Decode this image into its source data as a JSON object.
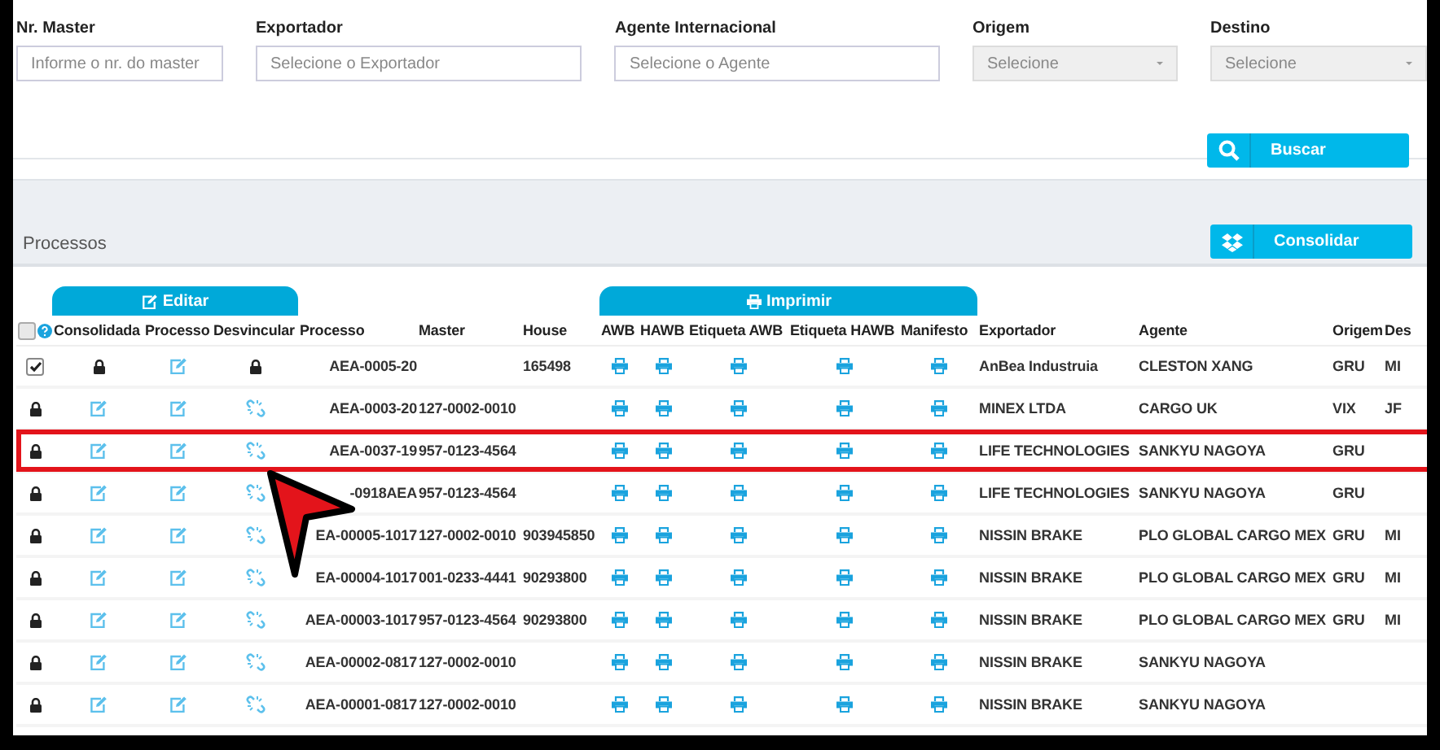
{
  "filters": [
    {
      "label": "Nr. Master",
      "kind": "text",
      "placeholder": "Informe o nr. do master",
      "disabled": false
    },
    {
      "label": "Exportador",
      "kind": "text",
      "placeholder": "Selecione o Exportador",
      "disabled": false
    },
    {
      "label": "Agente Internacional",
      "kind": "text",
      "placeholder": "Selecione o Agente",
      "disabled": false
    },
    {
      "label": "Origem",
      "kind": "select",
      "value": "Selecione",
      "disabled": true
    },
    {
      "label": "Destino",
      "kind": "select",
      "value": "Selecione",
      "disabled": true
    }
  ],
  "search_button": "Buscar",
  "section_title": "Processos",
  "consolidate_button": "Consolidar",
  "column_groups": [
    "Editar",
    "Imprimir"
  ],
  "select_all": {
    "checked": false
  },
  "columns": [
    "Consolidada",
    "Processo",
    "Desvincular",
    "Processo",
    "Master",
    "House",
    "AWB",
    "HAWB",
    "Etiqueta AWB",
    "Etiqueta HAWB",
    "Manifesto",
    "Exportador",
    "Agente",
    "Origem",
    "Des"
  ],
  "rows": [
    {
      "kind": "consolidated",
      "checked": true,
      "highlighted": false,
      "processo": "AEA-0005-20",
      "master": "",
      "house": "165498",
      "exportador": "AnBea Industruia",
      "agente": "CLESTON XANG",
      "origem": "GRU",
      "destino": "MI"
    },
    {
      "kind": "pending",
      "highlighted": false,
      "processo": "AEA-0003-20",
      "master": "127-0002-0010",
      "house": "",
      "exportador": "MINEX LTDA",
      "agente": "CARGO UK",
      "origem": "VIX",
      "destino": "JF"
    },
    {
      "kind": "pending",
      "highlighted": true,
      "processo": "AEA-0037-19",
      "master": "957-0123-4564",
      "house": "",
      "exportador": "LIFE TECHNOLOGIES",
      "agente": "SANKYU NAGOYA",
      "origem": "GRU",
      "destino": ""
    },
    {
      "kind": "pending",
      "highlighted": false,
      "processo": "-0918AEA",
      "master": "957-0123-4564",
      "house": "",
      "exportador": "LIFE TECHNOLOGIES",
      "agente": "SANKYU NAGOYA",
      "origem": "GRU",
      "destino": ""
    },
    {
      "kind": "pending",
      "highlighted": false,
      "processo": "EA-00005-1017",
      "master": "127-0002-0010",
      "house": "903945850",
      "exportador": "NISSIN BRAKE",
      "agente": "PLO GLOBAL CARGO MEX",
      "origem": "GRU",
      "destino": "MI"
    },
    {
      "kind": "pending",
      "highlighted": false,
      "processo": "EA-00004-1017",
      "master": "001-0233-4441",
      "house": "90293800",
      "exportador": "NISSIN BRAKE",
      "agente": "PLO GLOBAL CARGO MEX",
      "origem": "GRU",
      "destino": "MI"
    },
    {
      "kind": "pending",
      "highlighted": false,
      "processo": "AEA-00003-1017",
      "master": "957-0123-4564",
      "house": "90293800",
      "exportador": "NISSIN BRAKE",
      "agente": "PLO GLOBAL CARGO MEX",
      "origem": "GRU",
      "destino": "MI"
    },
    {
      "kind": "pending",
      "highlighted": false,
      "processo": "AEA-00002-0817",
      "master": "127-0002-0010",
      "house": "",
      "exportador": "NISSIN BRAKE",
      "agente": "SANKYU NAGOYA",
      "origem": "",
      "destino": ""
    },
    {
      "kind": "pending",
      "highlighted": false,
      "processo": "AEA-00001-0817",
      "master": "127-0002-0010",
      "house": "",
      "exportador": "NISSIN BRAKE",
      "agente": "SANKYU NAGOYA",
      "origem": "",
      "destino": ""
    }
  ]
}
